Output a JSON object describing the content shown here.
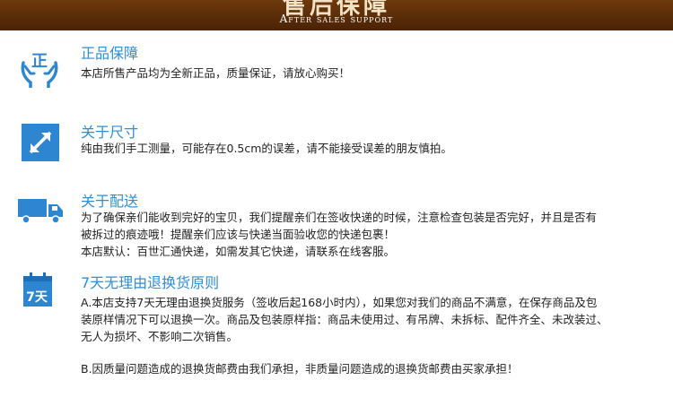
{
  "banner": {
    "title": "售后保障",
    "subtitle": "After sales support"
  },
  "sections": [
    {
      "icon": "hands-holding-zheng-icon",
      "title": "正品保障",
      "lines": [
        "本店所售产品均为全新正品，质量保证，请放心购买！"
      ]
    },
    {
      "icon": "resize-arrow-icon",
      "title": "关于尺寸",
      "lines": [
        "纯由我们手工测量，可能存在0.5cm的误差，请不能接受误差的朋友慎拍。"
      ]
    },
    {
      "icon": "delivery-truck-icon",
      "title": "关于配送",
      "lines": [
        "为了确保亲们能收到完好的宝贝，我们提醒亲们在签收快递的时候，注意检查包装是否完好，并且是否有",
        "被拆过的痕迹哦！提醒亲们应该与快递当面验收您的快递包裹！",
        "本店默认：百世汇通快递，如需发其它快递，请联系在线客服。"
      ]
    },
    {
      "icon": "seven-day-calendar-icon",
      "icon_text": "7天",
      "title": "7天无理由退换货原则",
      "lines": [
        "A.本店支持7天无理由退换货服务（签收后起168小时内），如果您对我们的商品不满意，在保存商品及包",
        "装原样情况下可以退换一次。商品及包装原样指：商品未使用过、有吊牌、未拆标、配件齐全、未改装过、",
        "无人为损坏、不影响二次销售。"
      ],
      "note": "B.因质量问题造成的退换货邮费由我们承担，非质量问题造成的退换货邮费由买家承担！"
    }
  ],
  "colors": {
    "banner_bg": "#5a2c08",
    "heading": "#2e8ed6",
    "icon_blue": "#2f86d0"
  }
}
